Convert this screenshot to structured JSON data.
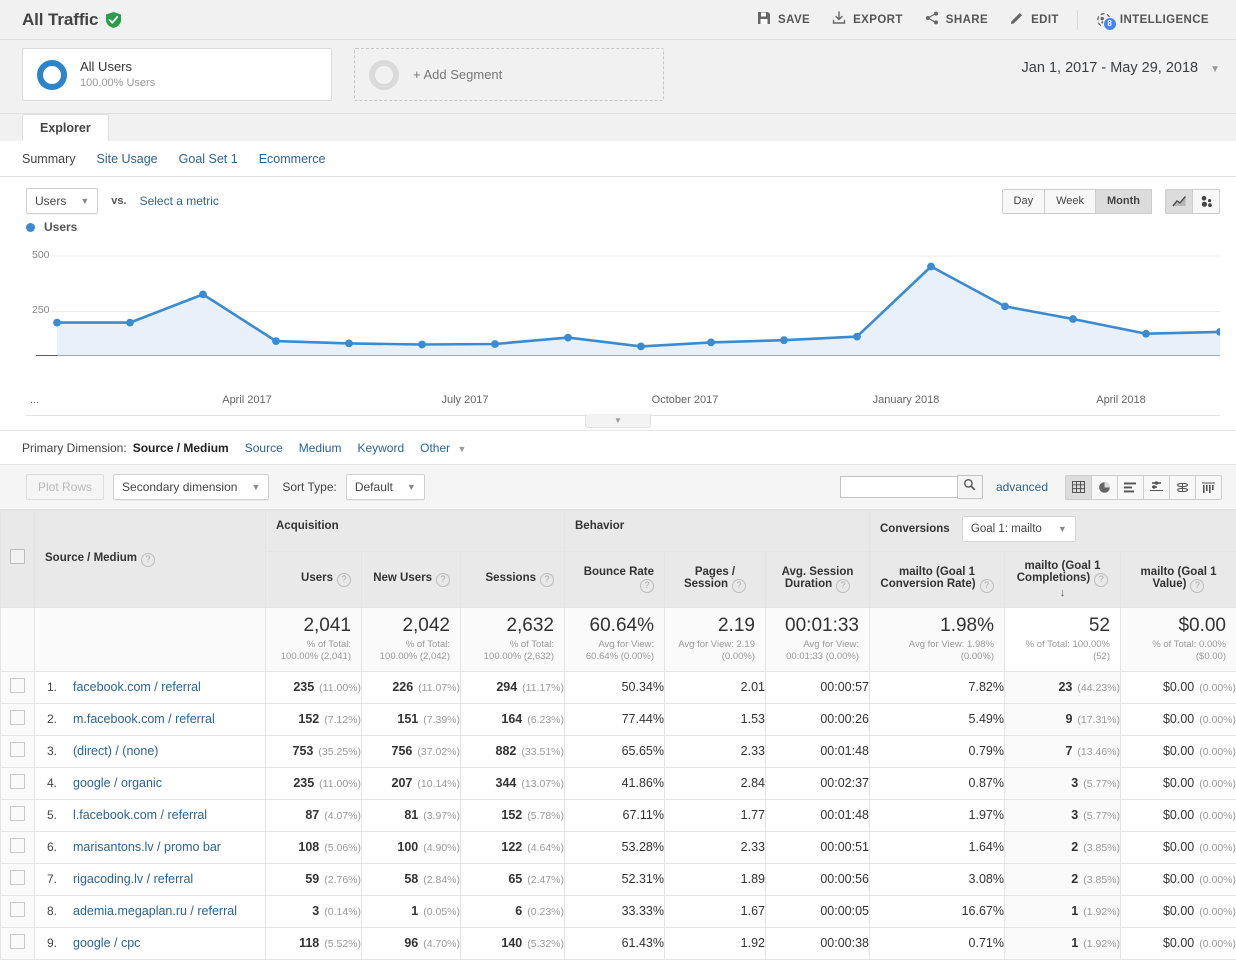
{
  "header": {
    "title": "All Traffic",
    "verified_icon": "verified-shield-icon",
    "actions": [
      {
        "label": "SAVE",
        "icon": "save-icon"
      },
      {
        "label": "EXPORT",
        "icon": "export-icon"
      },
      {
        "label": "SHARE",
        "icon": "share-icon"
      },
      {
        "label": "EDIT",
        "icon": "edit-pencil-icon"
      },
      {
        "label": "INTELLIGENCE",
        "icon": "intelligence-icon",
        "badge": "8"
      }
    ]
  },
  "segments": {
    "all_users": {
      "name": "All Users",
      "sub": "100.00% Users"
    },
    "add_segment": "+ Add Segment",
    "date_range": "Jan 1, 2017 - May 29, 2018"
  },
  "tabs": {
    "main": "Explorer",
    "sub": [
      {
        "label": "Summary",
        "active": true
      },
      {
        "label": "Site Usage",
        "active": false
      },
      {
        "label": "Goal Set 1",
        "active": false
      },
      {
        "label": "Ecommerce",
        "active": false
      }
    ]
  },
  "metric_bar": {
    "metric": "Users",
    "vs": "vs.",
    "select_metric": "Select a metric",
    "granularity": [
      "Day",
      "Week",
      "Month"
    ],
    "granularity_active": "Month",
    "chart_types": [
      "line-chart-icon",
      "motion-chart-icon"
    ]
  },
  "chart_legend": "Users",
  "chart_data": {
    "type": "line",
    "title": "",
    "xlabel": "",
    "ylabel": "Users",
    "ylim": [
      0,
      560
    ],
    "yticks": [
      250,
      500
    ],
    "grid": true,
    "legend": [
      "Users"
    ],
    "legend_position": "top-left",
    "series": [
      {
        "name": "Users",
        "color": "#3b8bd0",
        "fill": "#e8f1fa",
        "x": [
          "January 2017",
          "February 2017",
          "March 2017",
          "April 2017",
          "May 2017",
          "June 2017",
          "July 2017",
          "August 2017",
          "September 2017",
          "October 2017",
          "November 2017",
          "December 2017",
          "January 2018",
          "February 2018",
          "March 2018",
          "April 2018",
          "May 2018"
        ],
        "values": [
          150,
          150,
          277,
          103,
          90,
          84,
          87,
          123,
          74,
          97,
          109,
          129,
          505,
          217,
          158,
          75,
          85
        ]
      }
    ],
    "xticks": [
      "April 2017",
      "July 2017",
      "October 2017",
      "January 2018",
      "April 2018"
    ],
    "xtick_ellipsis": "..."
  },
  "primary_dimension": {
    "label": "Primary Dimension:",
    "active": "Source / Medium",
    "links": [
      "Source",
      "Medium",
      "Keyword"
    ],
    "other": "Other"
  },
  "controls": {
    "plot_rows": "Plot Rows",
    "secondary_dimension": "Secondary dimension",
    "sort_type_label": "Sort Type:",
    "sort_type": "Default",
    "search_value": "",
    "search_placeholder": "",
    "advanced": "advanced",
    "view_icons": [
      "table-view-icon",
      "pie-view-icon",
      "bar-view-icon",
      "comparison-view-icon",
      "pivot-view-icon",
      "performance-view-icon"
    ]
  },
  "table": {
    "groups": [
      {
        "label": "Acquisition",
        "span": 3
      },
      {
        "label": "Behavior",
        "span": 3
      },
      {
        "label": "Conversions",
        "span": 3,
        "goal_select": "Goal 1: mailto"
      }
    ],
    "dimension_header": "Source / Medium",
    "columns": [
      {
        "label": "Users",
        "align": "right"
      },
      {
        "label": "New Users",
        "align": "right"
      },
      {
        "label": "Sessions",
        "align": "right"
      },
      {
        "label": "Bounce Rate",
        "align": "right"
      },
      {
        "label": "Pages / Session",
        "align": "center"
      },
      {
        "label": "Avg. Session Duration",
        "align": "center"
      },
      {
        "label": "mailto (Goal 1 Conversion Rate)",
        "align": "center"
      },
      {
        "label": "mailto (Goal 1 Completions)",
        "align": "center",
        "sorted": true
      },
      {
        "label": "mailto (Goal 1 Value)",
        "align": "center"
      }
    ],
    "summary": [
      {
        "big": "2,041",
        "sub": "% of Total:\n100.00% (2,041)"
      },
      {
        "big": "2,042",
        "sub": "% of Total:\n100.00% (2,042)"
      },
      {
        "big": "2,632",
        "sub": "% of Total:\n100.00% (2,632)"
      },
      {
        "big": "60.64%",
        "sub": "Avg for View:\n60.64% (0.00%)"
      },
      {
        "big": "2.19",
        "sub": "Avg for View: 2.19\n(0.00%)"
      },
      {
        "big": "00:01:33",
        "sub": "Avg for View:\n00:01:33 (0.00%)"
      },
      {
        "big": "1.98%",
        "sub": "Avg for View: 1.98%\n(0.00%)"
      },
      {
        "big": "52",
        "sub": "% of Total: 100.00% (52)",
        "highlight": true
      },
      {
        "big": "$0.00",
        "sub": "% of Total: 0.00%\n($0.00)"
      }
    ],
    "rows": [
      {
        "index": "1.",
        "dimension": "facebook.com / referral",
        "users": "235",
        "users_pct": "(11.00%)",
        "new_users": "226",
        "new_users_pct": "(11.07%)",
        "sessions": "294",
        "sessions_pct": "(11.17%)",
        "bounce_rate": "50.34%",
        "pages_session": "2.01",
        "avg_duration": "00:00:57",
        "goal_rate": "7.82%",
        "goal_completions": "23",
        "goal_completions_pct": "(44.23%)",
        "goal_value": "$0.00",
        "goal_value_pct": "(0.00%)"
      },
      {
        "index": "2.",
        "dimension": "m.facebook.com / referral",
        "users": "152",
        "users_pct": "(7.12%)",
        "new_users": "151",
        "new_users_pct": "(7.39%)",
        "sessions": "164",
        "sessions_pct": "(6.23%)",
        "bounce_rate": "77.44%",
        "pages_session": "1.53",
        "avg_duration": "00:00:26",
        "goal_rate": "5.49%",
        "goal_completions": "9",
        "goal_completions_pct": "(17.31%)",
        "goal_value": "$0.00",
        "goal_value_pct": "(0.00%)"
      },
      {
        "index": "3.",
        "dimension": "(direct) / (none)",
        "users": "753",
        "users_pct": "(35.25%)",
        "new_users": "756",
        "new_users_pct": "(37.02%)",
        "sessions": "882",
        "sessions_pct": "(33.51%)",
        "bounce_rate": "65.65%",
        "pages_session": "2.33",
        "avg_duration": "00:01:48",
        "goal_rate": "0.79%",
        "goal_completions": "7",
        "goal_completions_pct": "(13.46%)",
        "goal_value": "$0.00",
        "goal_value_pct": "(0.00%)"
      },
      {
        "index": "4.",
        "dimension": "google / organic",
        "users": "235",
        "users_pct": "(11.00%)",
        "new_users": "207",
        "new_users_pct": "(10.14%)",
        "sessions": "344",
        "sessions_pct": "(13.07%)",
        "bounce_rate": "41.86%",
        "pages_session": "2.84",
        "avg_duration": "00:02:37",
        "goal_rate": "0.87%",
        "goal_completions": "3",
        "goal_completions_pct": "(5.77%)",
        "goal_value": "$0.00",
        "goal_value_pct": "(0.00%)"
      },
      {
        "index": "5.",
        "dimension": "l.facebook.com / referral",
        "users": "87",
        "users_pct": "(4.07%)",
        "new_users": "81",
        "new_users_pct": "(3.97%)",
        "sessions": "152",
        "sessions_pct": "(5.78%)",
        "bounce_rate": "67.11%",
        "pages_session": "1.77",
        "avg_duration": "00:01:48",
        "goal_rate": "1.97%",
        "goal_completions": "3",
        "goal_completions_pct": "(5.77%)",
        "goal_value": "$0.00",
        "goal_value_pct": "(0.00%)"
      },
      {
        "index": "6.",
        "dimension": "marisantons.lv / promo bar",
        "users": "108",
        "users_pct": "(5.06%)",
        "new_users": "100",
        "new_users_pct": "(4.90%)",
        "sessions": "122",
        "sessions_pct": "(4.64%)",
        "bounce_rate": "53.28%",
        "pages_session": "2.33",
        "avg_duration": "00:00:51",
        "goal_rate": "1.64%",
        "goal_completions": "2",
        "goal_completions_pct": "(3.85%)",
        "goal_value": "$0.00",
        "goal_value_pct": "(0.00%)"
      },
      {
        "index": "7.",
        "dimension": "rigacoding.lv / referral",
        "users": "59",
        "users_pct": "(2.76%)",
        "new_users": "58",
        "new_users_pct": "(2.84%)",
        "sessions": "65",
        "sessions_pct": "(2.47%)",
        "bounce_rate": "52.31%",
        "pages_session": "1.89",
        "avg_duration": "00:00:56",
        "goal_rate": "3.08%",
        "goal_completions": "2",
        "goal_completions_pct": "(3.85%)",
        "goal_value": "$0.00",
        "goal_value_pct": "(0.00%)"
      },
      {
        "index": "8.",
        "dimension": "ademia.megaplan.ru / referral",
        "users": "3",
        "users_pct": "(0.14%)",
        "new_users": "1",
        "new_users_pct": "(0.05%)",
        "sessions": "6",
        "sessions_pct": "(0.23%)",
        "bounce_rate": "33.33%",
        "pages_session": "1.67",
        "avg_duration": "00:00:05",
        "goal_rate": "16.67%",
        "goal_completions": "1",
        "goal_completions_pct": "(1.92%)",
        "goal_value": "$0.00",
        "goal_value_pct": "(0.00%)"
      },
      {
        "index": "9.",
        "dimension": "google / cpc",
        "users": "118",
        "users_pct": "(5.52%)",
        "new_users": "96",
        "new_users_pct": "(4.70%)",
        "sessions": "140",
        "sessions_pct": "(5.32%)",
        "bounce_rate": "61.43%",
        "pages_session": "1.92",
        "avg_duration": "00:00:38",
        "goal_rate": "0.71%",
        "goal_completions": "1",
        "goal_completions_pct": "(1.92%)",
        "goal_value": "$0.00",
        "goal_value_pct": "(0.00%)"
      }
    ]
  },
  "colors": {
    "accent": "#2a6496",
    "line": "#3b8bd0",
    "fill": "#e8f1fa",
    "verified_green": "#2a9d4a",
    "badge_blue": "#4285f4"
  }
}
